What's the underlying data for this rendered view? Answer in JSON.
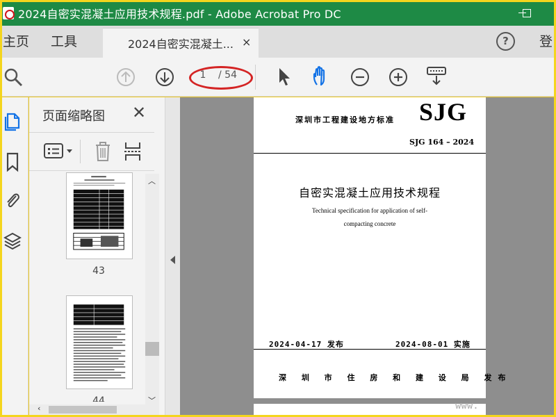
{
  "window": {
    "title": "2024自密实混凝土应用技术规程.pdf - Adobe Acrobat Pro DC"
  },
  "tabs": {
    "home": "主页",
    "tools": "工具",
    "document": "2024自密实混凝土...",
    "close": "×",
    "help": "?",
    "signin": "登"
  },
  "toolbar": {
    "current_page": "1",
    "page_total": "/ 54",
    "annotation_color": "#d42424"
  },
  "panel": {
    "title": "页面缩略图",
    "close": "✕",
    "thumbnails": [
      {
        "page": "43"
      },
      {
        "page": "44"
      }
    ]
  },
  "document": {
    "standard_type": "深圳市工程建设地方标准",
    "logo": "SJG",
    "standard_number": "SJG 164 – 2024",
    "title_zh": "自密实混凝土应用技术规程",
    "title_en_line1": "Technical specification for application of self-",
    "title_en_line2": "compacting concrete",
    "issue_date": "2024-04-17 发布",
    "impl_date": "2024-08-01 实施",
    "publisher": "深 圳 市 住 房 和 建 设 局   发布"
  },
  "watermark": "www."
}
